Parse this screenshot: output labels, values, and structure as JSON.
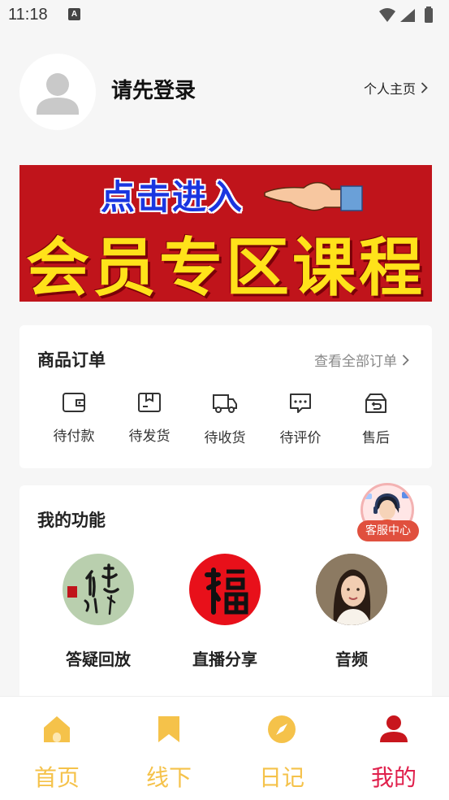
{
  "status_bar": {
    "time": "11:18",
    "notification_icon": "A",
    "icons": [
      "wifi-icon",
      "signal-icon",
      "battery-icon"
    ]
  },
  "profile": {
    "login_prompt": "请先登录",
    "homepage_link": "个人主页"
  },
  "banner": {
    "top_text": "点击进入",
    "main_text": "会员专区课程",
    "colors": {
      "background": "#c0141b",
      "top_text": "#1a36e0",
      "main_text": "#ffe21a"
    }
  },
  "orders": {
    "title": "商品订单",
    "view_all": "查看全部订单",
    "items": [
      {
        "label": "待付款",
        "icon": "wallet-icon"
      },
      {
        "label": "待发货",
        "icon": "package-icon"
      },
      {
        "label": "待收货",
        "icon": "truck-icon"
      },
      {
        "label": "待评价",
        "icon": "comment-icon"
      },
      {
        "label": "售后",
        "icon": "return-icon"
      }
    ]
  },
  "functions": {
    "title": "我的功能",
    "items": [
      {
        "label": "答疑回放",
        "icon": "calligraphy-image"
      },
      {
        "label": "直播分享",
        "icon": "fu-character-image"
      },
      {
        "label": "音频",
        "icon": "portrait-image"
      }
    ]
  },
  "support": {
    "label": "客服中心"
  },
  "bottom_nav": {
    "items": [
      {
        "label": "首页",
        "icon": "home-icon",
        "active": false
      },
      {
        "label": "线下",
        "icon": "bookmark-icon",
        "active": false
      },
      {
        "label": "日记",
        "icon": "compass-icon",
        "active": false
      },
      {
        "label": "我的",
        "icon": "user-icon",
        "active": true
      }
    ],
    "colors": {
      "inactive": "#f5c24a",
      "active": "#e0204c"
    }
  }
}
